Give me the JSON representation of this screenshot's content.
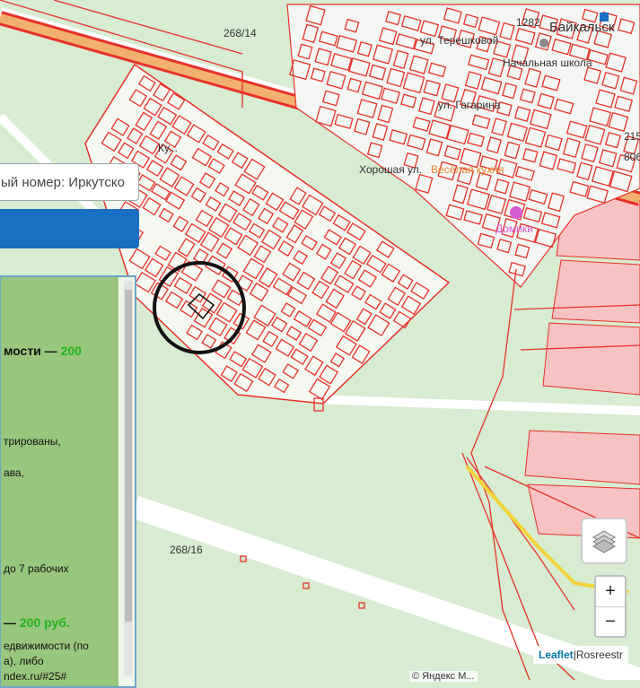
{
  "map": {
    "labels": {
      "road_top": "268/14",
      "road_bottom": "268/16",
      "num_1282": "1282",
      "town": "Байкальск",
      "street_tereshkovoy": "ул. Терешковой",
      "school": "Начальная школа",
      "street_gagarina": "ул. Гагарина",
      "street_khoroshaya": "Хорошая ул.",
      "veselaya": "Весёлая кухня",
      "doma": "Домики",
      "road_215": "215",
      "road_806": "806",
      "street_k": "Ку..."
    }
  },
  "search": {
    "value": "ый номер: Иркутско"
  },
  "panel": {
    "line1_text": "мости — ",
    "line1_price": "200",
    "line2": "трированы,",
    "line3": "ава,",
    "line4": "до 7 рабочих",
    "line5_text": "— ",
    "line5_price": "200 руб.",
    "line6": "едвижимости (по",
    "line7": "а), либо",
    "line8": "ndex.ru/#25#"
  },
  "controls": {
    "zoom_in": "+",
    "zoom_out": "−",
    "layers_icon": "layers-icon"
  },
  "attribution": {
    "leaflet": "Leaflet",
    "separator": " | ",
    "source": "Rosreestr",
    "yandex": "© Яндекс М..."
  },
  "colors": {
    "parcel": "#e8312b",
    "highlight_circle": "#111111",
    "panel_accent": "#1fb51f",
    "button": "#1a6fc2"
  }
}
